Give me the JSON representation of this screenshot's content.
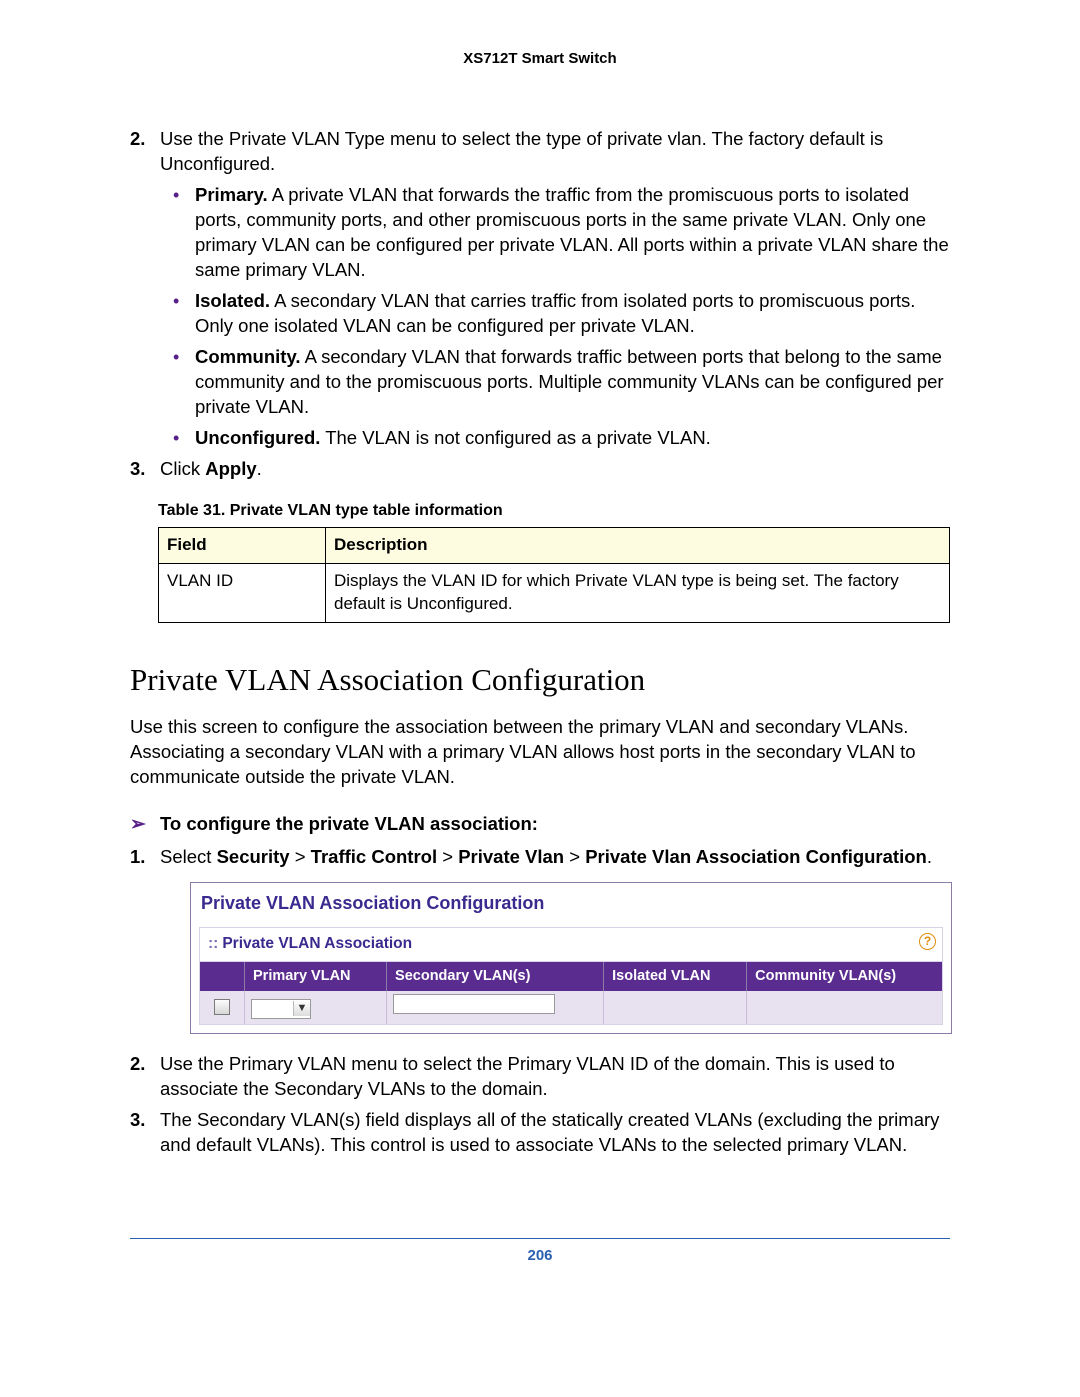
{
  "header": {
    "title": "XS712T Smart Switch"
  },
  "step2": {
    "num": "2.",
    "text": "Use the Private VLAN Type menu to select the type of private vlan. The factory default is Unconfigured.",
    "bullets": [
      {
        "label": "Primary.",
        "text": " A private VLAN that forwards the traffic from the promiscuous ports to isolated ports, community ports, and other promiscuous ports in the same private VLAN. Only one primary VLAN can be configured per private VLAN. All ports within a private VLAN share the same primary VLAN."
      },
      {
        "label": "Isolated.",
        "text": " A secondary VLAN that carries traffic from isolated ports to promiscuous ports. Only one isolated VLAN can be configured per private VLAN."
      },
      {
        "label": "Community.",
        "text": " A secondary VLAN that forwards traffic between ports that belong to the same community and to the promiscuous ports. Multiple community VLANs can be configured per private VLAN."
      },
      {
        "label": "Unconfigured.",
        "text": " The VLAN is not configured as a private VLAN."
      }
    ]
  },
  "step3": {
    "num": "3.",
    "pre": "Click ",
    "bold": "Apply",
    "post": "."
  },
  "table31": {
    "caption": "Table 31.  Private VLAN type table information",
    "headers": {
      "field": "Field",
      "desc": "Description"
    },
    "rows": [
      {
        "field": "VLAN ID",
        "desc": "Displays the VLAN ID for which Private VLAN type is being set. The factory default is Unconfigured."
      }
    ]
  },
  "section": {
    "heading": "Private VLAN Association Configuration",
    "intro": "Use this screen to configure the association between the primary VLAN and secondary VLANs. Associating a secondary VLAN with a primary VLAN allows host ports in the secondary VLAN to communicate outside the private VLAN."
  },
  "proc": {
    "arrow": "➢",
    "title": "To configure the private VLAN association:"
  },
  "stepA1": {
    "num": "1.",
    "pre": "Select ",
    "nav": [
      "Security",
      "Traffic Control",
      "Private Vlan",
      "Private Vlan Association Configuration"
    ],
    "gt": ">",
    "post": "."
  },
  "ui": {
    "panelTitle": "Private VLAN Association Configuration",
    "subTitle": "Private VLAN Association",
    "help": "?",
    "cols": {
      "c1": "Primary VLAN",
      "c2": "Secondary VLAN(s)",
      "c3": "Isolated VLAN",
      "c4": "Community VLAN(s)"
    }
  },
  "stepA2": {
    "num": "2.",
    "text": "Use the Primary VLAN menu to select the Primary VLAN ID of the domain. This is used to associate the Secondary VLANs to the domain."
  },
  "stepA3": {
    "num": "3.",
    "text": "The Secondary VLAN(s) field displays all of the statically created VLANs (excluding the primary and default VLANs). This control is used to associate VLANs to the selected primary VLAN."
  },
  "footer": {
    "page": "206"
  }
}
